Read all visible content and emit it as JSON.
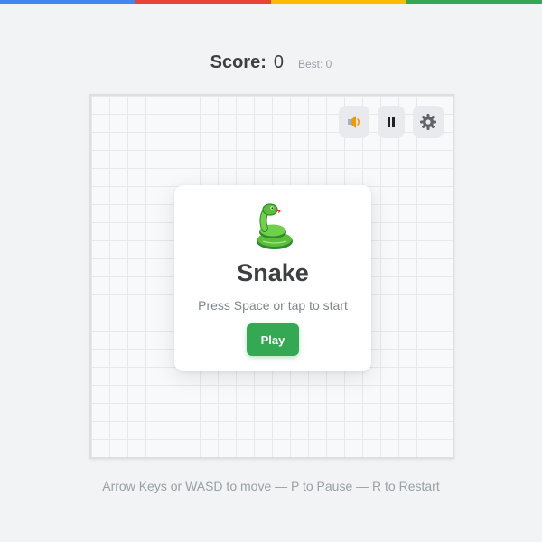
{
  "accent_colors": [
    "#4285f4",
    "#ea4335",
    "#fbbc05",
    "#34a853"
  ],
  "score": {
    "label": "Score:",
    "value": "0",
    "best_label": "Best: 0"
  },
  "controls": {
    "sound_icon": "speaker-icon",
    "pause_icon": "pause-icon",
    "settings_icon": "gear-icon"
  },
  "overlay": {
    "emoji": "snake-emoji",
    "title": "Snake",
    "subtitle": "Press Space or tap to start",
    "play_label": "Play"
  },
  "help_text": "Arrow Keys or WASD to move — P to Pause — R to Restart",
  "colors": {
    "snake": "#34a853",
    "food": "#ea4335",
    "play_button": "#34a853"
  }
}
